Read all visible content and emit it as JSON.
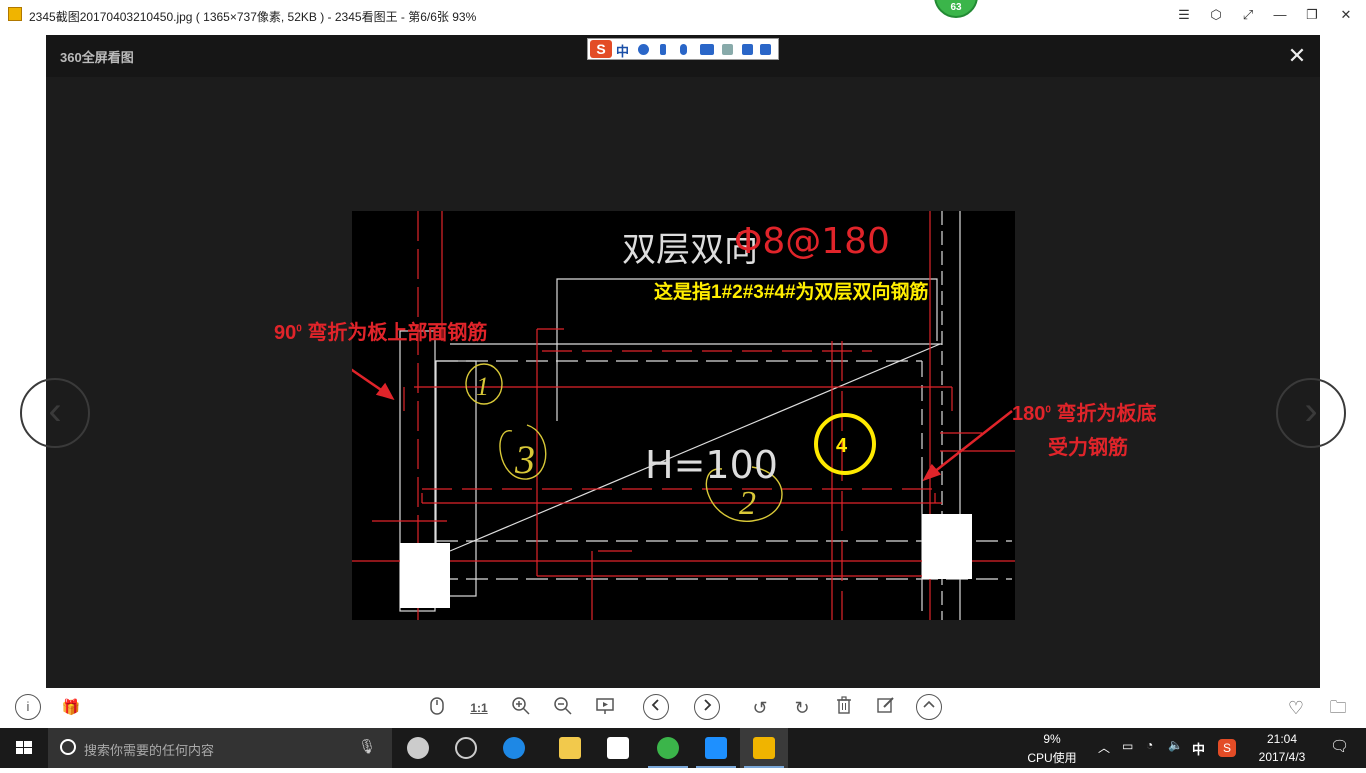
{
  "window": {
    "title": "2345截图20170403210450.jpg ( 1365×737像素, 52KB ) - 2345看图王 - 第6/6张 93%",
    "badge": "63",
    "controls": [
      "☰",
      "⬡",
      "⤢",
      "—",
      "❐",
      "✕"
    ]
  },
  "viewer": {
    "logo": "360全屏看图",
    "close": "✕",
    "ime": {
      "logo": "S",
      "mode": "中"
    },
    "prev": "‹",
    "next": "›"
  },
  "image": {
    "cad_title": "双层双向",
    "cad_spec": "Φ8@180",
    "cad_height": "H=100",
    "marks": [
      "1",
      "2",
      "3"
    ],
    "annotation_top": "这是指1#2#3#4#为双层双向钢筋",
    "annotation_left_num": "90",
    "annotation_left_sup": "0",
    "annotation_left_text": "弯折为板上部面钢筋",
    "annotation_right_num": "180",
    "annotation_right_sup": "0",
    "annotation_right_text1": "弯折为板底",
    "annotation_right_text2": "受力钢筋",
    "circle_label": "4"
  },
  "toolbar": {
    "info": "i",
    "gift": "🎁",
    "actual_size": "1:1",
    "favorite": "♡",
    "folder": "🗀"
  },
  "taskbar": {
    "search_placeholder": "搜索你需要的任何内容",
    "cpu_percent": "9%",
    "cpu_label": "CPU使用",
    "ime": "中",
    "time": "21:04",
    "date": "2017/4/3"
  }
}
